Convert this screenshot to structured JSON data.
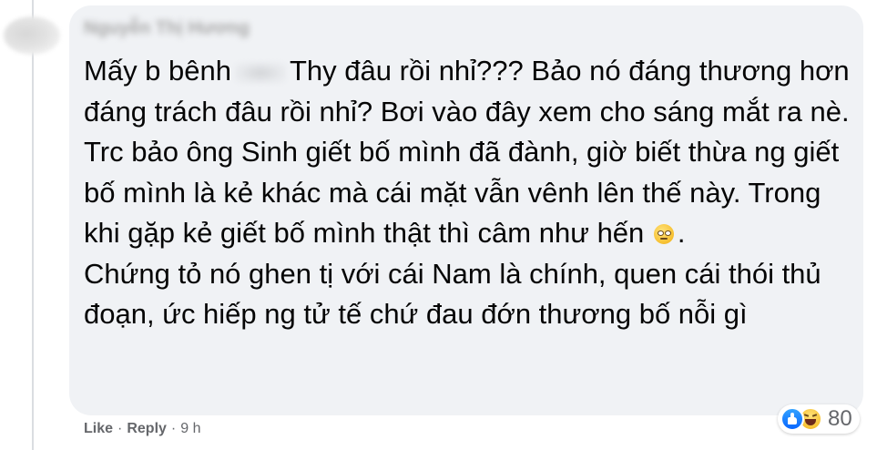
{
  "comment": {
    "author": "Nguyễn Thị Hương",
    "body_line1_before": "Mấy b bênh",
    "body_line1_after": "Thy đâu rồi nhỉ??? Bảo nó đáng thương hơn đáng trách đâu rồi nhỉ? Bơi vào đây xem cho sáng mắt ra nè. Trc bảo ông Sinh giết bố mình đã đành, giờ biết thừa ng giết bố mình là kẻ khác mà cái mặt vẫn vênh lên thế này. Trong khi gặp kẻ giết bố mình thật thì câm như hến",
    "body_line1_end": ".",
    "body_paragraph2": "Chứng tỏ nó ghen tị với cái Nam là chính, quen cái thói thủ đoạn, ức hiếp ng tử tế chứ đau đớn thương bố nỗi gì",
    "emoji_name": "rolling-eyes-emoji"
  },
  "reactions": {
    "icons": [
      "like-icon",
      "haha-icon"
    ],
    "count": "80"
  },
  "actions": {
    "like_label": "Like",
    "reply_label": "Reply",
    "separator": "·",
    "time": "9 h"
  },
  "colors": {
    "bubble": "#f0f2f5",
    "text": "#050505",
    "secondary": "#65676b",
    "like_blue": "#0866ff"
  }
}
